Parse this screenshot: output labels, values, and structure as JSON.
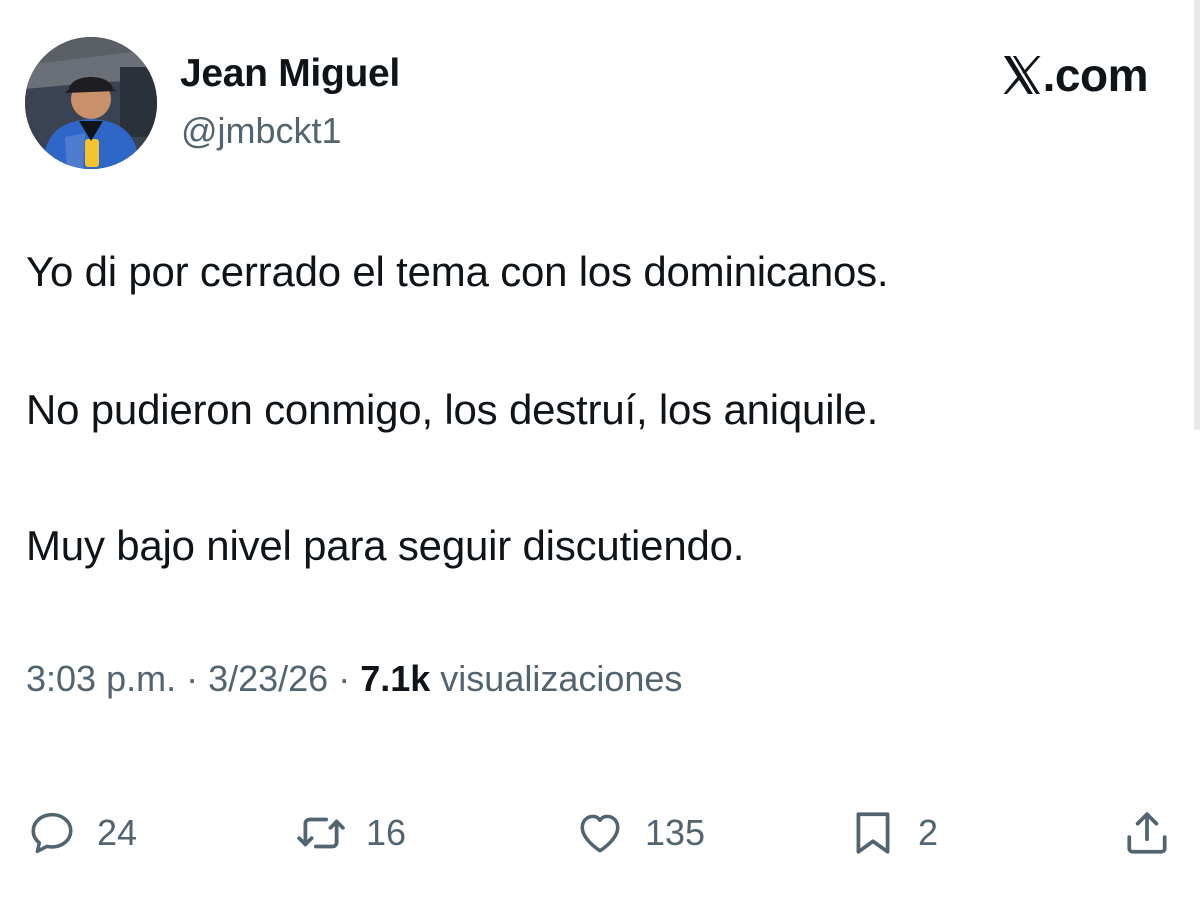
{
  "author": {
    "display_name": "Jean Miguel",
    "handle": "@jmbckt1",
    "avatar_icon": "profile-photo"
  },
  "brand": {
    "text": ".com",
    "icon": "x-logo-icon"
  },
  "tweet": {
    "lines": [
      "Yo di por cerrado el tema con los dominicanos.",
      "No pudieron conmigo, los destruí, los aniquile.",
      "Muy bajo nivel para seguir discutiendo."
    ]
  },
  "meta": {
    "time": "3:03 p.m.",
    "separator": " · ",
    "date": "3/23/26",
    "views_count": "7.1k",
    "views_label": " visualizaciones"
  },
  "actions": {
    "reply": {
      "count": "24",
      "icon": "reply-icon"
    },
    "repost": {
      "count": "16",
      "icon": "repost-icon"
    },
    "like": {
      "count": "135",
      "icon": "heart-icon"
    },
    "bookmark": {
      "count": "2",
      "icon": "bookmark-icon"
    },
    "share": {
      "icon": "share-icon"
    }
  },
  "colors": {
    "text_primary": "#0f1419",
    "text_secondary": "#536471",
    "background": "#ffffff"
  }
}
